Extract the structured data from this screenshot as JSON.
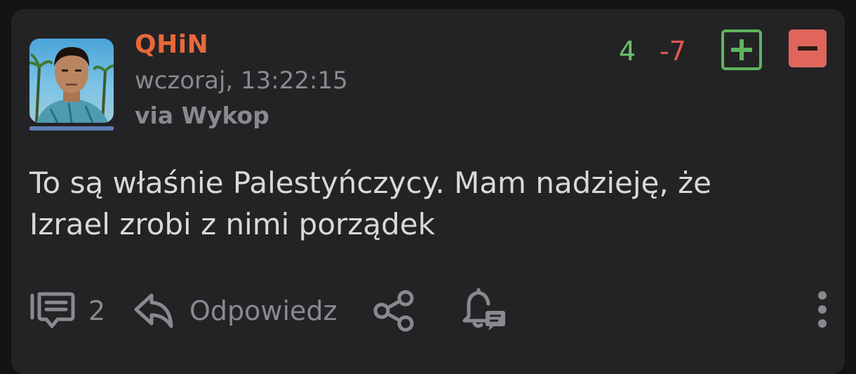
{
  "post": {
    "author": "QHiN",
    "timestamp": "wczoraj, 13:22:15",
    "source": "via Wykop",
    "votes": {
      "plus": "4",
      "minus": "-7"
    },
    "body_lines": [
      "To są właśnie Palestyńczycy. Mam nadzieję, że",
      "Izrael zrobi z nimi porządek"
    ],
    "comments_count": "2",
    "reply_label": "Odpowiedz"
  },
  "icons": [
    "avatar",
    "plus-icon",
    "minus-icon",
    "comment-icon",
    "reply-icon",
    "share-icon",
    "notification-bell-icon",
    "more-vertical-icon"
  ],
  "colors": {
    "background": "#131313",
    "card": "#232326",
    "author": "#e8683a",
    "upvote": "#6cc06a",
    "downvote": "#e0584f",
    "muted": "#8a8a8e",
    "text": "#d9d9dc"
  }
}
